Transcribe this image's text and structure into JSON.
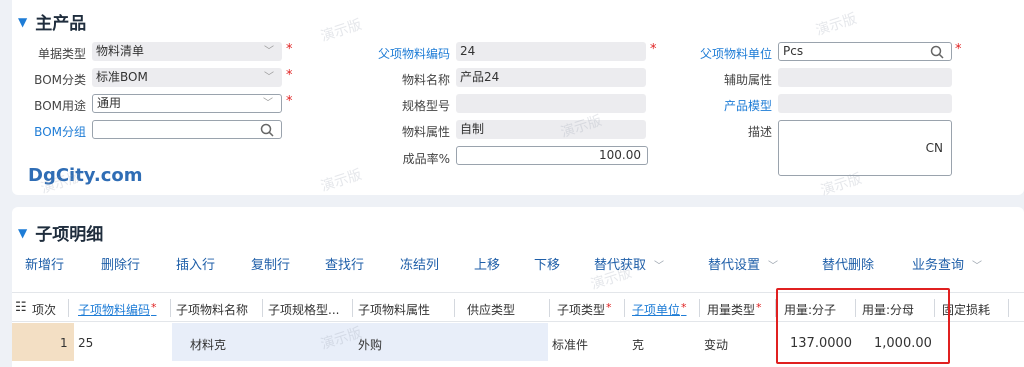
{
  "main_section": {
    "title": "主产品",
    "fields": {
      "doc_type": {
        "label": "单据类型",
        "value": "物料清单"
      },
      "bom_category": {
        "label": "BOM分类",
        "value": "标准BOM"
      },
      "bom_usage": {
        "label": "BOM用途",
        "value": "通用"
      },
      "bom_group": {
        "label": "BOM分组",
        "value": ""
      },
      "parent_code": {
        "label": "父项物料编码",
        "value": "24"
      },
      "material_name": {
        "label": "物料名称",
        "value": "产品24"
      },
      "spec_model": {
        "label": "规格型号",
        "value": ""
      },
      "material_attr": {
        "label": "物料属性",
        "value": "自制"
      },
      "yield_rate": {
        "label": "成品率%",
        "value": "100.00"
      },
      "parent_unit": {
        "label": "父项物料单位",
        "value": "Pcs"
      },
      "aux_attr": {
        "label": "辅助属性",
        "value": ""
      },
      "product_model": {
        "label": "产品模型",
        "value": ""
      },
      "description": {
        "label": "描述",
        "value": "CN"
      }
    },
    "logo": "DgCity.com"
  },
  "sub_section": {
    "title": "子项明细",
    "toolbar": [
      "新增行",
      "删除行",
      "插入行",
      "复制行",
      "查找行",
      "冻结列",
      "上移",
      "下移",
      "替代获取",
      "替代设置",
      "替代删除",
      "业务查询"
    ],
    "columns": [
      "项次",
      "子项物料编码",
      "子项物料名称",
      "子项规格型...",
      "子项物料属性",
      "供应类型",
      "子项类型",
      "子项单位",
      "用量类型",
      "用量:分子",
      "用量:分母",
      "固定损耗"
    ],
    "rows": [
      {
        "idx": "1",
        "code": "25",
        "name": "材料克",
        "spec": "",
        "attr": "外购",
        "supply_type": "",
        "item_type": "标准件",
        "unit": "克",
        "usage_type": "变动",
        "numerator": "137.0000",
        "denominator": "1,000.00",
        "fixed_loss": ""
      }
    ]
  },
  "watermark": "演示版",
  "colors": {
    "accent": "#1e7cd6",
    "required": "#e02020",
    "highlight_box": "#e02020",
    "readonly_bg": "#ececef"
  }
}
